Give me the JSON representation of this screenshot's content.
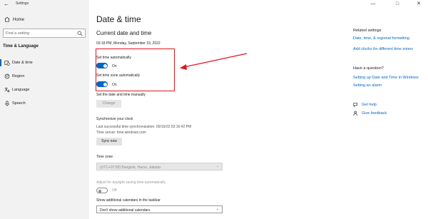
{
  "window": {
    "app_title": "Settings"
  },
  "sidebar": {
    "home_label": "Home",
    "search_placeholder": "Find a setting",
    "section_label": "Time & Language",
    "items": [
      {
        "label": "Date & time"
      },
      {
        "label": "Region"
      },
      {
        "label": "Language"
      },
      {
        "label": "Speech"
      }
    ]
  },
  "main": {
    "page_title": "Date & time",
    "sub_title": "Current date and time",
    "current_datetime": "03:18 PM, Monday, September 19, 2022",
    "set_time_auto": {
      "label": "Set time automatically",
      "state": "On"
    },
    "set_timezone_auto": {
      "label": "Set time zone automatically",
      "state": "On"
    },
    "set_manual": {
      "label": "Set the date and time manually",
      "button": "Change"
    },
    "sync": {
      "heading": "Synchronize your clock",
      "last_sync": "Last successful time synchronization: 09/19/22 03:16:42 PM",
      "server": "Time server: time.windows.com",
      "button": "Sync now"
    },
    "timezone": {
      "label": "Time zone",
      "value": "(UTC+07:00) Bangkok, Hanoi, Jakarta"
    },
    "dst": {
      "label": "Adjust for daylight saving time automatically",
      "state": "Off"
    },
    "calendars": {
      "label": "Show additional calendars in the taskbar",
      "value": "Don't show additional calendars"
    }
  },
  "right": {
    "related_heading": "Related settings",
    "related_links": [
      "Date, time, & regional formatting",
      "Add clocks for different time zones"
    ],
    "question_heading": "Have a question?",
    "question_links": [
      "Setting up Date and Time in Windows",
      "Setting an alarm"
    ],
    "help_link": "Get help",
    "feedback_link": "Give feedback"
  },
  "colors": {
    "accent": "#0067c0",
    "highlight": "#e0161e",
    "sidebar_bg": "#f2f2f2"
  }
}
